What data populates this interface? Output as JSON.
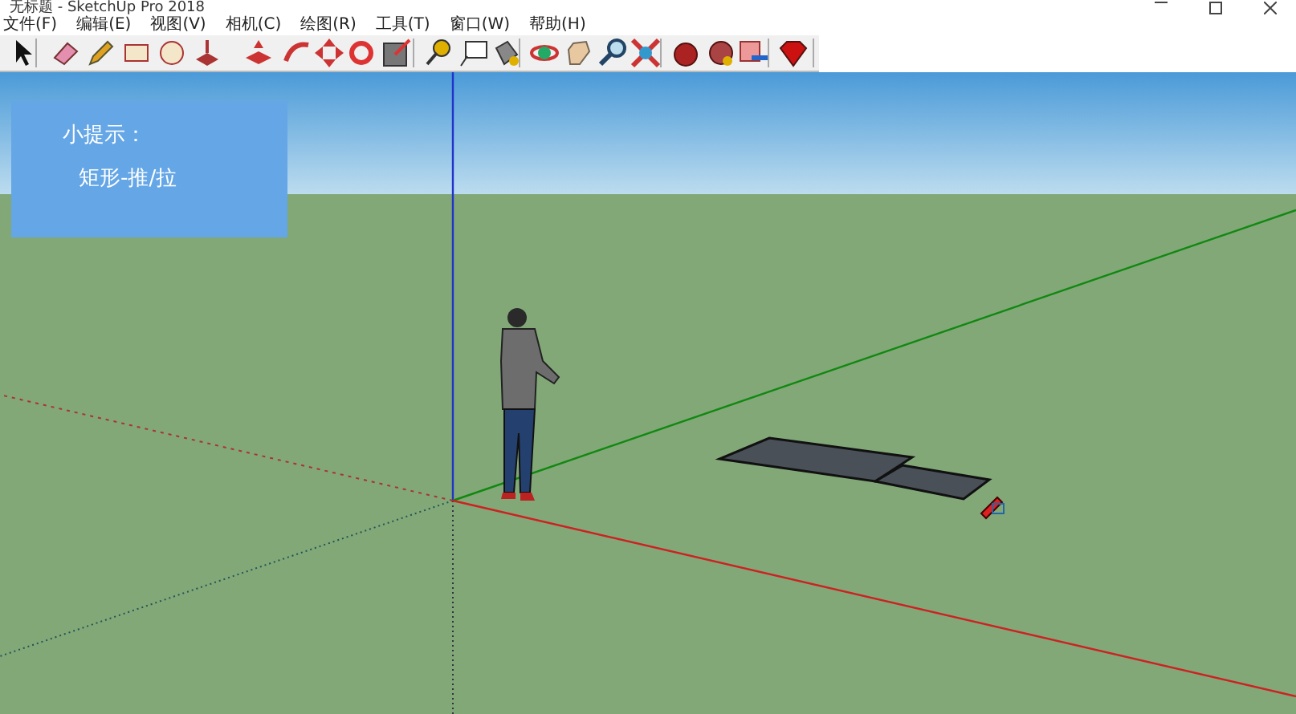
{
  "window": {
    "title": "无标题 - SketchUp Pro 2018"
  },
  "menu": [
    "文件(F)",
    "编辑(E)",
    "视图(V)",
    "相机(C)",
    "绘图(R)",
    "工具(T)",
    "窗口(W)",
    "帮助(H)"
  ],
  "hint_panel": {
    "title": "小提示：",
    "text": "矩形-推/拉"
  }
}
